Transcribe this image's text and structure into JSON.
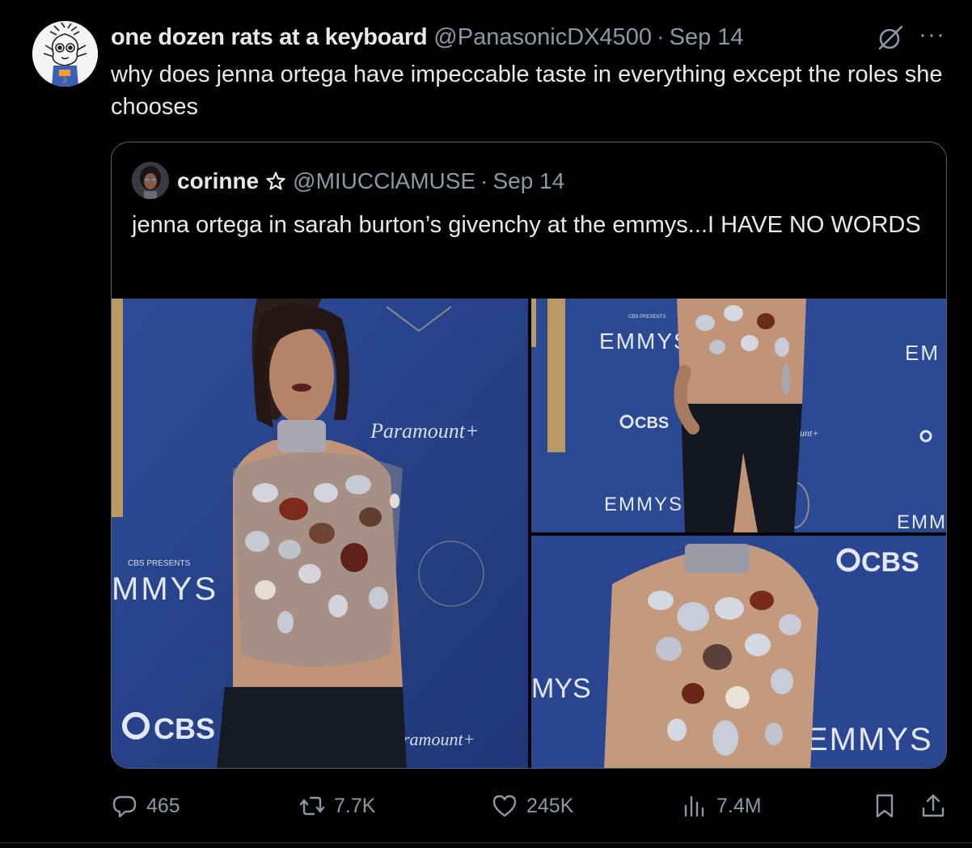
{
  "tweet": {
    "display_name": "one dozen rats at a keyboard",
    "handle": "@PanasonicDX4500",
    "separator": "·",
    "date": "Sep 14",
    "more": "···",
    "text": "why does jenna ortega have impeccable taste in everything except the roles she chooses",
    "avatar_icon": "cartoon-rat-avatar"
  },
  "quote": {
    "display_name": "corinne",
    "badge_icon": "star-outline-icon",
    "handle": "@MIUCClAMUSE",
    "separator": "·",
    "date": "Sep 14",
    "text": "jenna ortega in sarah burton’s givenchy at the emmys...I HAVE NO WORDS"
  },
  "media_signage": {
    "main_paramount": "Paramount+",
    "main_cbs_presents": "CBS PRESENTS",
    "main_emmys": "MMYS",
    "main_cbs": "CBS",
    "main_paramount_bottom": "ramount+",
    "tr_cbs_presents": "CBS PRESENTS",
    "tr_emmys_top": "EMMYS",
    "tr_cbs": "CBS",
    "tr_emmys_bottom": "EMMYS",
    "tr_em_right": "EM",
    "tr_emm_right": "EMM",
    "tr_unt": "unt+",
    "br_cbs": "CBS",
    "br_emmys": "EMMYS",
    "br_mys": "MYS"
  },
  "actions": {
    "reply_count": "465",
    "retweet_count": "7.7K",
    "like_count": "245K",
    "views_count": "7.4M"
  },
  "colors": {
    "background": "#000000",
    "text_primary": "#e7e9ea",
    "text_secondary": "#8b98a5",
    "border": "#536471",
    "backdrop_blue": "#2a4690"
  }
}
